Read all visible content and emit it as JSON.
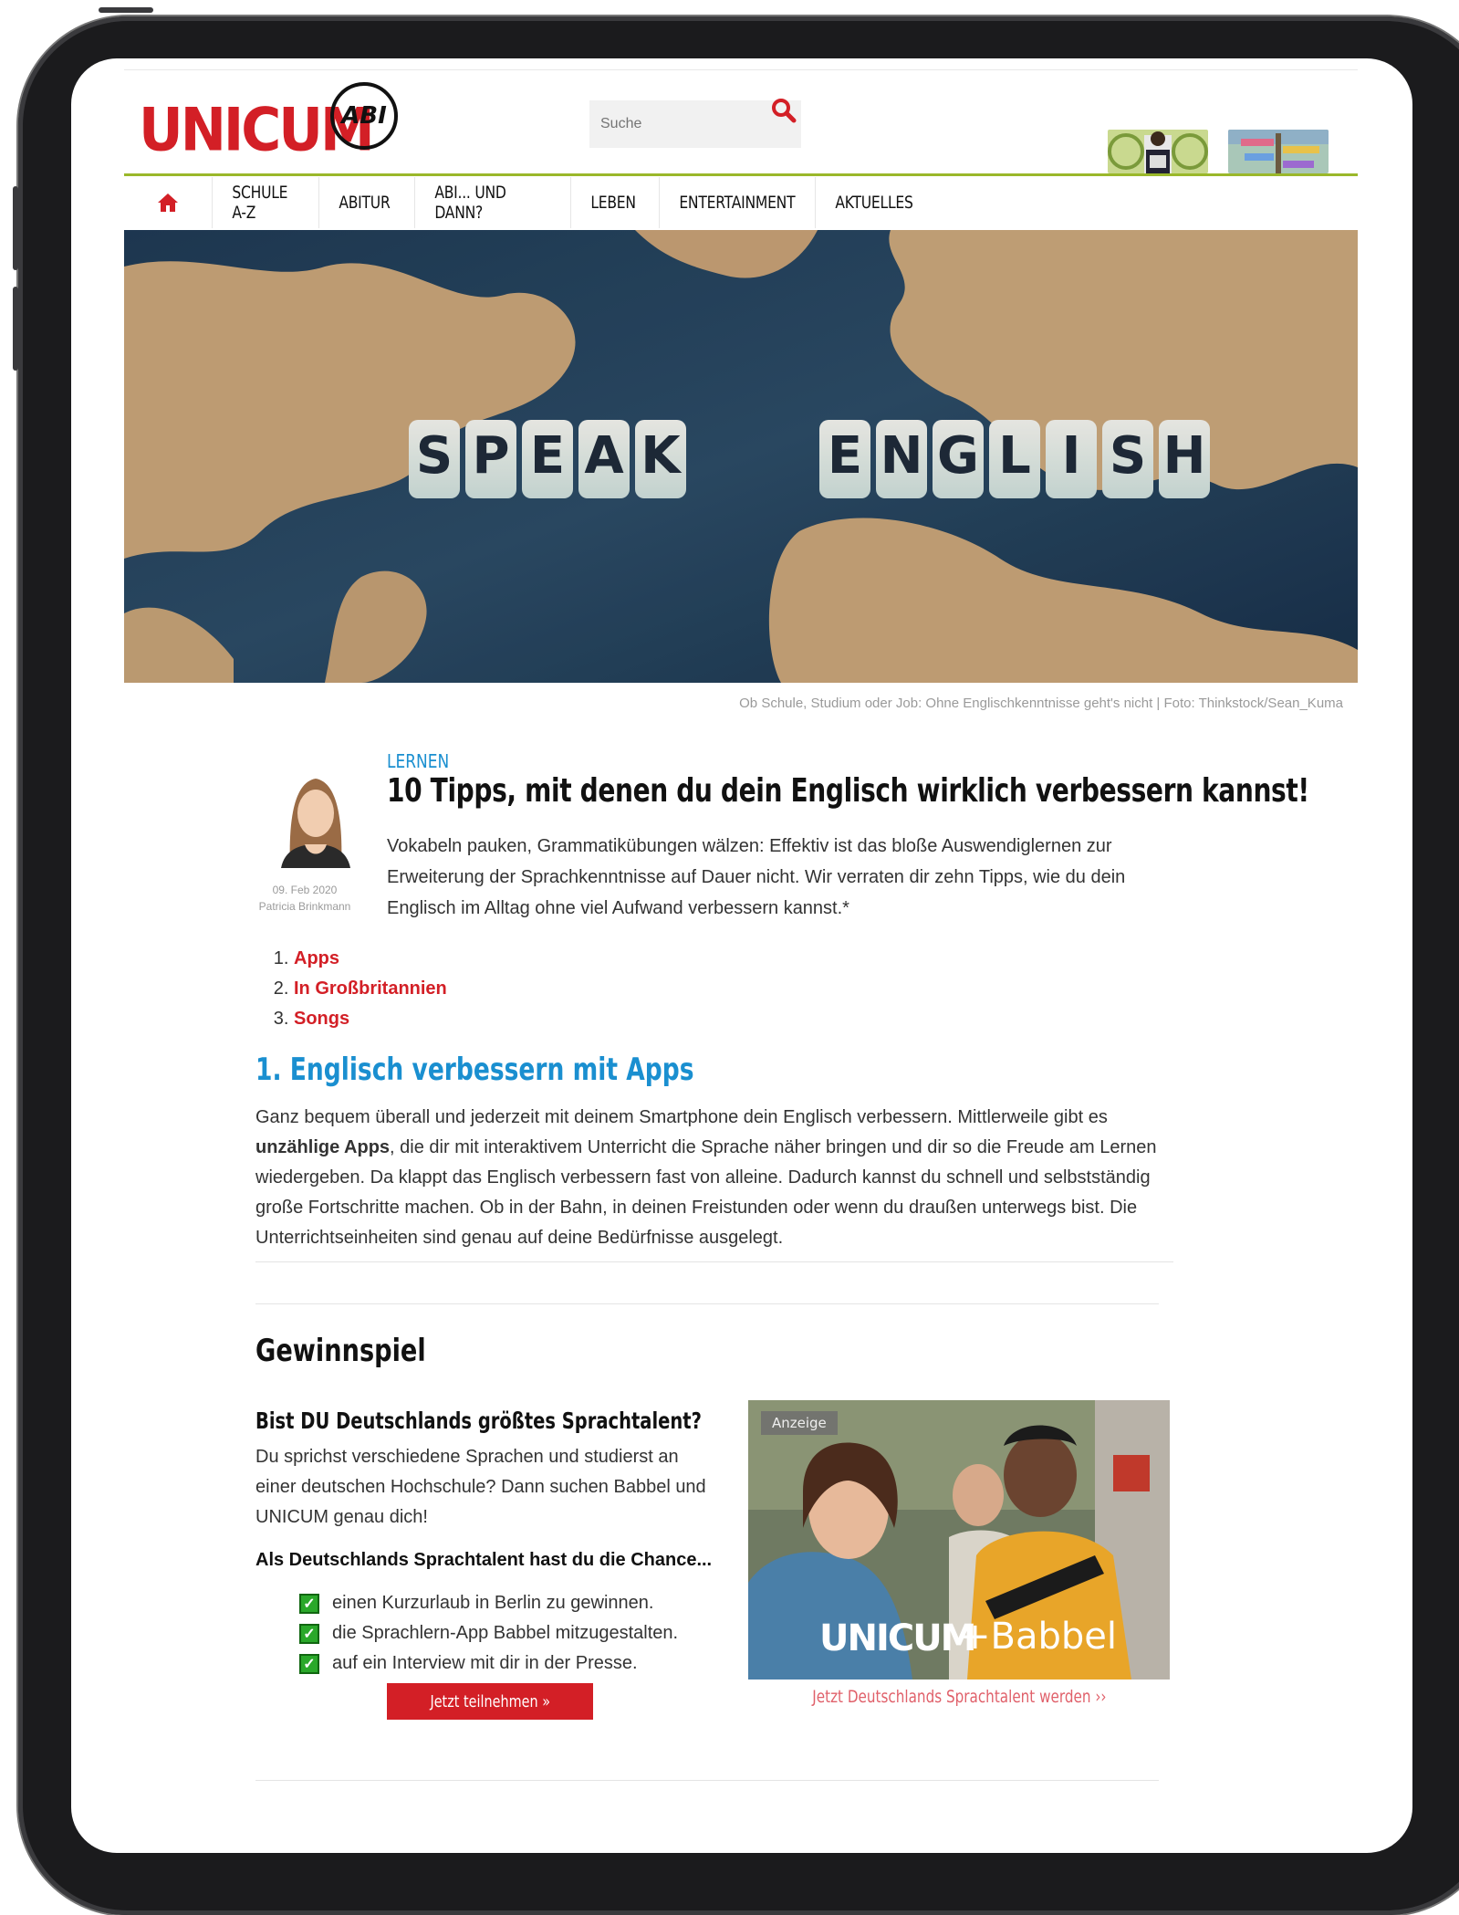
{
  "header": {
    "logo_text": "UNICUM",
    "logo_badge": "ABI",
    "search_placeholder": "Suche"
  },
  "nav": {
    "items": [
      "SCHULE A-Z",
      "ABITUR",
      "ABI... UND DANN?",
      "LEBEN",
      "ENTERTAINMENT",
      "AKTUELLES"
    ]
  },
  "hero": {
    "image_text_1": "SPEAK",
    "image_text_2": "ENGLISH",
    "caption": "Ob Schule, Studium oder Job: Ohne Englischkenntnisse geht's nicht | Foto: Thinkstock/Sean_Kuma"
  },
  "article": {
    "category": "LERNEN",
    "title": "10 Tipps, mit denen du dein Englisch wirklich verbessern kannst!",
    "intro": "Vokabeln pauken, Grammatikübungen wälzen: Effektiv ist das bloße Auswendiglernen zur Erweiterung der Sprachkenntnisse auf Dauer nicht. Wir verraten dir zehn Tipps, wie du dein Englisch im Alltag ohne viel Aufwand verbessern kannst.*",
    "date": "09. Feb 2020",
    "author": "Patricia Brinkmann",
    "toc": [
      "Apps",
      "In Großbritannien",
      "Songs"
    ],
    "section1_title": "1. Englisch verbessern mit Apps",
    "section1_p1": "Ganz bequem überall und jederzeit mit deinem Smartphone dein Englisch verbessern. Mittlerweile gibt es ",
    "section1_bold": "unzählige Apps",
    "section1_p2": ", die dir mit interaktivem Unterricht die Sprache näher bringen und dir so die Freude am Lernen wiedergeben. Da klappt das Englisch verbessern fast von alleine. Dadurch kannst du schnell und selbstständig große Fortschritte machen. Ob in der Bahn, in deinen Freistunden oder wenn du draußen unterwegs bist. Die Unterrichtseinheiten sind genau auf deine Bedürfnisse ausgelegt."
  },
  "promo": {
    "section_title": "Gewinnspiel",
    "headline": "Bist DU Deutschlands größtes Sprachtalent?",
    "text": "Du sprichst verschiedene Sprachen und studierst an einer deutschen Hochschule? Dann suchen Babbel und UNICUM genau dich!",
    "bold_line": "Als Deutschlands Sprachtalent hast du die Chance...",
    "checks": [
      "einen Kurzurlaub in Berlin zu gewinnen.",
      "die Sprachlern-App Babbel mitzugestalten.",
      "auf ein Interview mit dir in der Presse."
    ],
    "button": "Jetzt teilnehmen »",
    "ad_badge": "Anzeige",
    "ad_brand_1": "UNICUM",
    "ad_brand_2": "+Babbel",
    "ad_link": "Jetzt Deutschlands Sprachtalent werden ››"
  },
  "colors": {
    "brand_red": "#d31f26",
    "link_blue": "#1a8fd0",
    "header_green": "#9ab82a",
    "check_green": "#2aa82a"
  }
}
